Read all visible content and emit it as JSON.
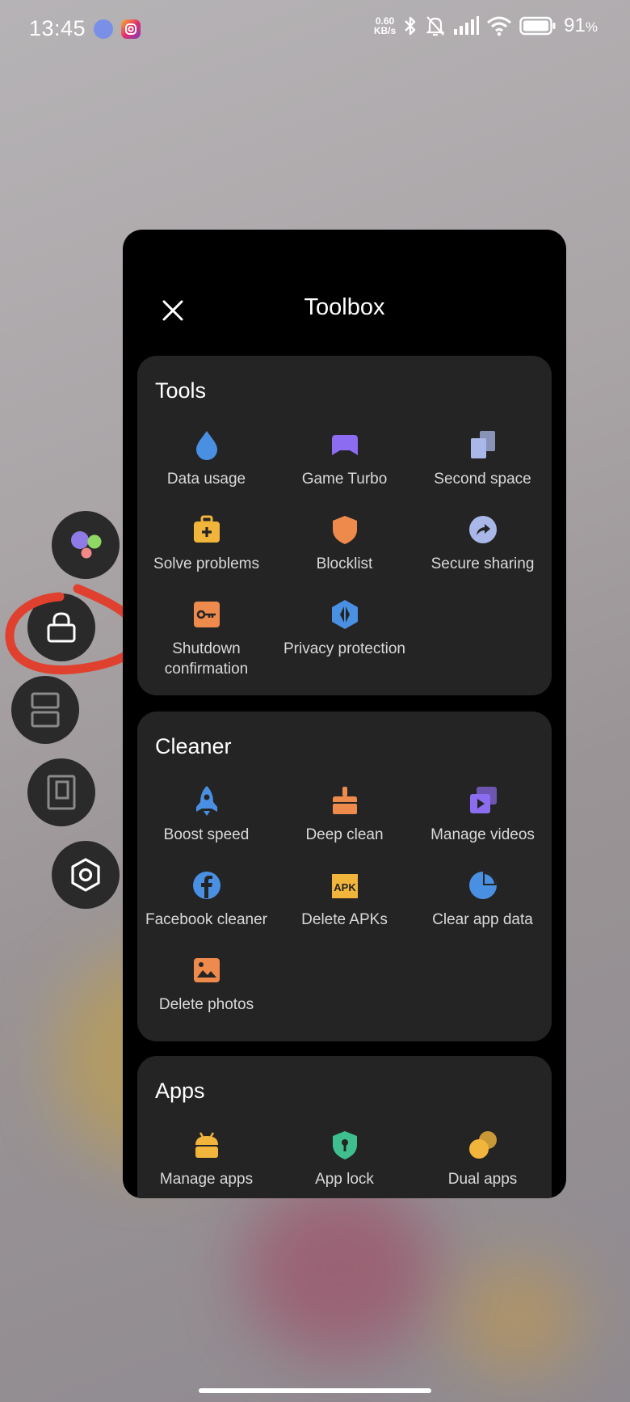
{
  "status_bar": {
    "time": "13:45",
    "net_speed_value": "0.60",
    "net_speed_unit": "KB/s",
    "battery": "91",
    "battery_unit": "%",
    "icons": [
      "bluetooth-icon",
      "bell-muted-icon",
      "signal-icon",
      "wifi-icon",
      "battery-icon"
    ]
  },
  "side_toolbar": {
    "items": [
      "apps-icon",
      "lock-icon",
      "split-screen-icon",
      "floating-window-icon",
      "settings-icon"
    ]
  },
  "toolbox": {
    "title": "Toolbox",
    "sections": [
      {
        "title": "Tools",
        "items": [
          {
            "label": "Data usage",
            "icon": "water-drop-icon",
            "color": "#4a90e2"
          },
          {
            "label": "Game Turbo",
            "icon": "gamepad-icon",
            "color": "#8c6cf0"
          },
          {
            "label": "Second space",
            "icon": "second-space-icon",
            "color": "#a9b8e8"
          },
          {
            "label": "Solve problems",
            "icon": "first-aid-kit-icon",
            "color": "#f2b53c"
          },
          {
            "label": "Blocklist",
            "icon": "shield-icon",
            "color": "#ef8a4d"
          },
          {
            "label": "Secure sharing",
            "icon": "share-arrow-icon",
            "color": "#a9b8e8"
          },
          {
            "label": "Shutdown confirmation",
            "icon": "key-icon",
            "color": "#ef8a4d"
          },
          {
            "label": "Privacy protection",
            "icon": "privacy-icon",
            "color": "#4a90e2"
          }
        ]
      },
      {
        "title": "Cleaner",
        "items": [
          {
            "label": "Boost speed",
            "icon": "rocket-icon",
            "color": "#4a90e2"
          },
          {
            "label": "Deep clean",
            "icon": "broom-icon",
            "color": "#ef8a4d"
          },
          {
            "label": "Manage videos",
            "icon": "video-icon",
            "color": "#8c6cf0"
          },
          {
            "label": "Facebook cleaner",
            "icon": "facebook-icon",
            "color": "#4a90e2"
          },
          {
            "label": "Delete APKs",
            "icon": "apk-icon",
            "color": "#f2b53c",
            "badge": "APK"
          },
          {
            "label": "Clear app data",
            "icon": "pie-chart-icon",
            "color": "#4a90e2"
          },
          {
            "label": "Delete photos",
            "icon": "photo-icon",
            "color": "#ef8a4d"
          }
        ]
      },
      {
        "title": "Apps",
        "items": [
          {
            "label": "Manage apps",
            "icon": "android-icon",
            "color": "#f2b53c"
          },
          {
            "label": "App lock",
            "icon": "shield-lock-icon",
            "color": "#3fbf8f"
          },
          {
            "label": "Dual apps",
            "icon": "dual-circles-icon",
            "color": "#f2b53c"
          }
        ]
      }
    ]
  }
}
